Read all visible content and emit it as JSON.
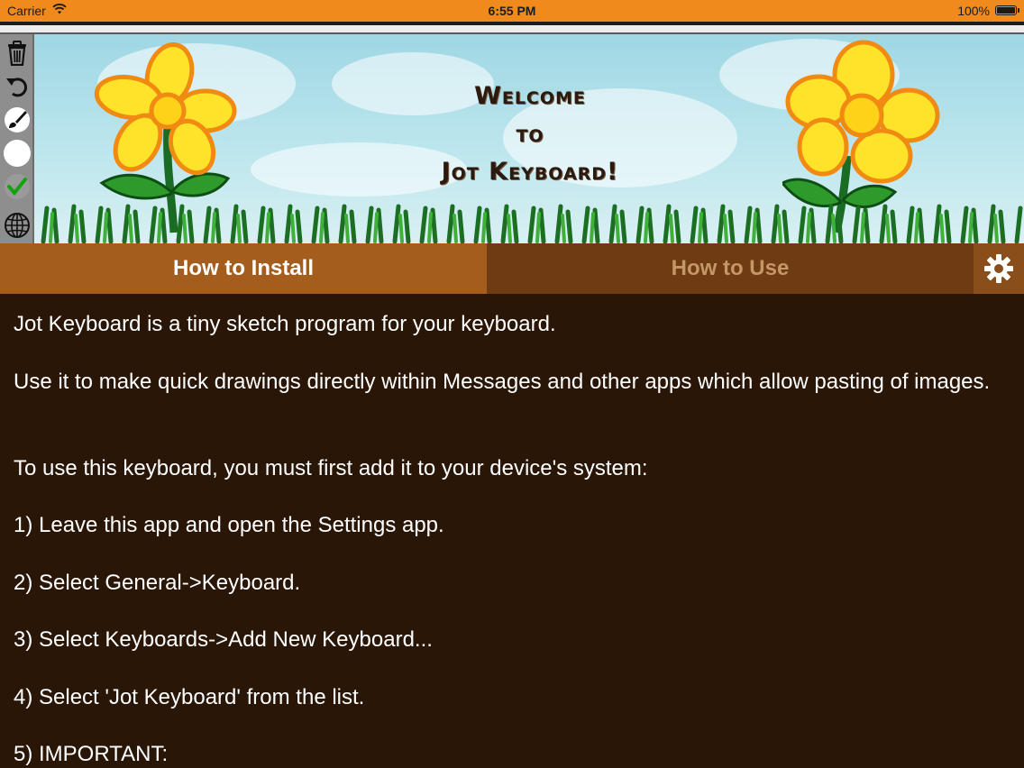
{
  "status_bar": {
    "carrier": "Carrier",
    "time": "6:55 PM",
    "battery": "100%"
  },
  "toolbar": {
    "tools": [
      {
        "icon": "trash-icon"
      },
      {
        "icon": "undo-icon"
      },
      {
        "icon": "brush-icon"
      },
      {
        "icon": "color-circle-icon"
      },
      {
        "icon": "checkmark-icon"
      },
      {
        "icon": "globe-icon"
      }
    ]
  },
  "banner": {
    "line1": "Welcome",
    "line2": "to",
    "line3": "Jot Keyboard!"
  },
  "tabs": {
    "install_label": "How to Install",
    "use_label": "How to Use",
    "selected": "How to Install"
  },
  "content": {
    "paragraphs": [
      "Jot Keyboard is a tiny sketch program for your keyboard.",
      "Use it to make quick drawings directly within Messages and other apps which allow pasting of images.",
      "To use this keyboard, you must first add it to your device's system:",
      "1) Leave this app and open the Settings app.",
      "2) Select General->Keyboard.",
      "3) Select Keyboards->Add New Keyboard...",
      "4) Select 'Jot Keyboard' from the list.",
      "5) IMPORTANT:"
    ]
  },
  "colors": {
    "status_bar": "#f18a1c",
    "tab_selected": "#a45d1d",
    "tab_unselected": "#6e3b12",
    "content_bg": "#2a1607"
  }
}
